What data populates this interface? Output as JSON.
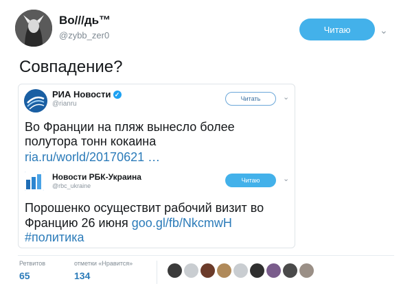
{
  "tweet": {
    "author_name": "Во///дь™",
    "author_handle": "@zybb_zer0",
    "follow_label": "Читаю",
    "text": "Совпадение?"
  },
  "quote1": {
    "name": "РИА Новости",
    "handle": "@rianru",
    "follow_label": "Читать",
    "text": "Во Франции на пляж вынесло более полутора тонн кокаина",
    "link": "ria.ru/world/20170621 …"
  },
  "quote2": {
    "name": "Новости РБК-Украина",
    "handle": "@rbc_ukraine",
    "follow_label": "Читаю",
    "text": "Порошенко осуществит рабочий визит во Францию 26 июня ",
    "link": "goo.gl/fb/NkcmwH",
    "hashtag": "#политика"
  },
  "stats": {
    "retweets_label": "Ретвитов",
    "retweets_value": "65",
    "likes_label": "отметки «Нравится»",
    "likes_value": "134"
  },
  "likers": [
    "#3a3a3a",
    "#c9cdd1",
    "#6b3b2a",
    "#b08a5a",
    "#c9cdd1",
    "#2f2f2f",
    "#7a5c8c",
    "#4a4a4a",
    "#9a8f86"
  ],
  "colors": {
    "accent": "#43b1ea",
    "link": "#2b7bb9"
  }
}
